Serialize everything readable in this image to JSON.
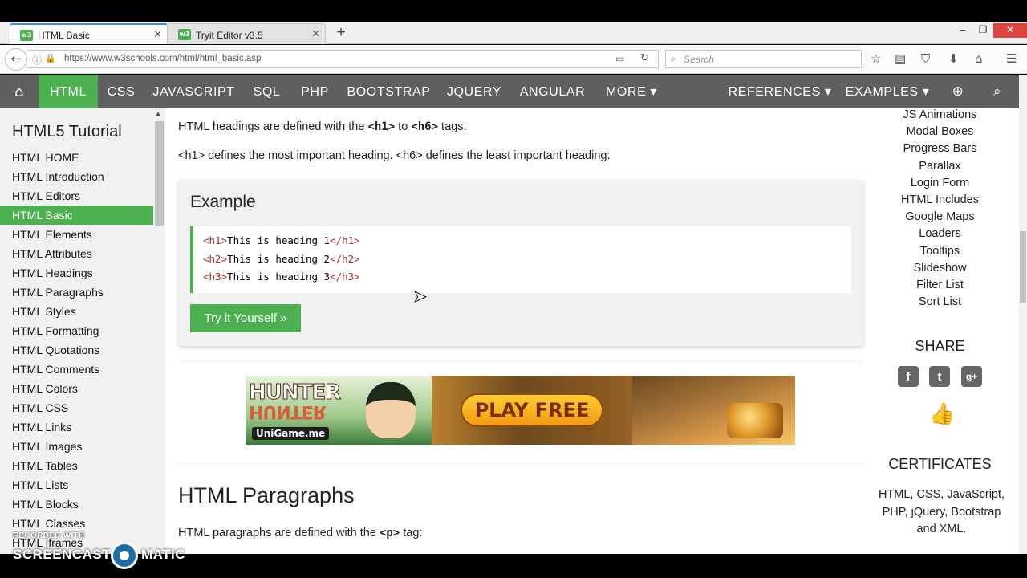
{
  "browser": {
    "tabs": [
      {
        "title": "HTML Basic",
        "favicon": "w3",
        "active": true
      },
      {
        "title": "Tryit Editor v3.5",
        "favicon": "w3",
        "active": false
      }
    ],
    "new_tab": "+",
    "window_controls": {
      "minimize": "‒",
      "maximize": "❐",
      "close": "✕"
    },
    "url": "https://www.w3schools.com/html/html_basic.asp",
    "search_placeholder": "Search",
    "toolbar_icons": [
      "star-icon",
      "reading-list-icon",
      "pocket-icon",
      "download-icon",
      "home-icon",
      "menu-icon"
    ]
  },
  "topnav": {
    "items": [
      "HTML",
      "CSS",
      "JAVASCRIPT",
      "SQL",
      "PHP",
      "BOOTSTRAP",
      "JQUERY",
      "ANGULAR",
      "MORE ▾"
    ],
    "right_items": [
      "REFERENCES ▾",
      "EXAMPLES ▾"
    ],
    "active": "HTML",
    "accent": "#4caf50",
    "bar_color": "#5f5f5f"
  },
  "sidebar": {
    "title": "HTML5 Tutorial",
    "items": [
      "HTML HOME",
      "HTML Introduction",
      "HTML Editors",
      "HTML Basic",
      "HTML Elements",
      "HTML Attributes",
      "HTML Headings",
      "HTML Paragraphs",
      "HTML Styles",
      "HTML Formatting",
      "HTML Quotations",
      "HTML Comments",
      "HTML Colors",
      "HTML CSS",
      "HTML Links",
      "HTML Images",
      "HTML Tables",
      "HTML Lists",
      "HTML Blocks",
      "HTML Classes",
      "HTML Iframes"
    ],
    "active": "HTML Basic"
  },
  "main": {
    "headings_intro": {
      "before": "HTML headings are defined with the ",
      "tag1": "<h1>",
      "mid": " to ",
      "tag2": "<h6>",
      "after": " tags."
    },
    "headings_desc": "<h1> defines the most important heading. <h6> defines the least important heading:",
    "example": {
      "title": "Example",
      "code": [
        {
          "open": "<h1>",
          "text": "This is heading 1",
          "close": "</h1>"
        },
        {
          "open": "<h2>",
          "text": "This is heading 2",
          "close": "</h2>"
        },
        {
          "open": "<h3>",
          "text": "This is heading 3",
          "close": "</h3>"
        }
      ],
      "button": "Try it Yourself »"
    },
    "ad": {
      "logo_text": "HUNTER",
      "logo_sub": "UniGame.me",
      "cta": "PLAY FREE"
    },
    "section_title": "HTML Paragraphs",
    "para_intro": {
      "before": "HTML paragraphs are defined with the ",
      "tag": "<p>",
      "after": " tag:"
    }
  },
  "right_column": {
    "links": [
      "JS Animations",
      "Modal Boxes",
      "Progress Bars",
      "Parallax",
      "Login Form",
      "HTML Includes",
      "Google Maps",
      "Loaders",
      "Tooltips",
      "Slideshow",
      "Filter List",
      "Sort List"
    ],
    "share_title": "SHARE",
    "share_icons": {
      "facebook": "f",
      "twitter": "t",
      "google": "g+"
    },
    "certificates_title": "CERTIFICATES",
    "certificates_text": "HTML, CSS, JavaScript, PHP, jQuery, Bootstrap and XML."
  },
  "watermark": {
    "recorded_with": "RECORDED WITH",
    "brand_left": "SCREENCAST",
    "brand_right": "MATIC"
  }
}
